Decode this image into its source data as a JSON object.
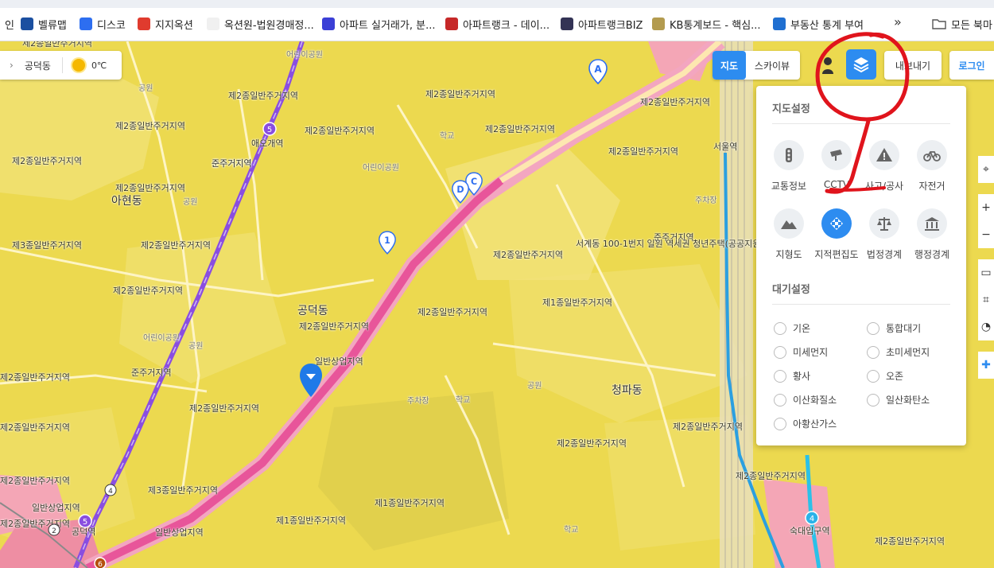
{
  "bookmarks": [
    {
      "label": "인",
      "icon": "blank-icon",
      "color": "#ffffff"
    },
    {
      "label": "벨류맵",
      "icon": "valuemap-icon",
      "color": "#1b4fa0"
    },
    {
      "label": "디스코",
      "icon": "disco-icon",
      "color": "#2d6ef0"
    },
    {
      "label": "지지옥션",
      "icon": "ggauction-icon",
      "color": "#e03b2e"
    },
    {
      "label": "옥션원-법원경매정...",
      "icon": "auction1-icon",
      "color": "#f0f0f0"
    },
    {
      "label": "아파트 실거래가, 분...",
      "icon": "hogangnono-icon",
      "color": "#3b3fd6"
    },
    {
      "label": "아파트랭크 - 데이...",
      "icon": "r-icon",
      "color": "#c62828"
    },
    {
      "label": "아파트랭크BIZ",
      "icon": "chart-icon",
      "color": "#333355"
    },
    {
      "label": "KB통계보드 - 핵심...",
      "icon": "kb-icon",
      "color": "#b39b4f"
    },
    {
      "label": "부동산 통계 부여",
      "icon": "reb-icon",
      "color": "#1f6fd1"
    }
  ],
  "bookmarks_more": "»",
  "bookmarks_folder": "모든 북마",
  "location": {
    "dong": "공덕동",
    "temperature": "0℃"
  },
  "map_controls": {
    "map": "지도",
    "skyview": "스카이뷰",
    "save": "내보내기",
    "login": "로그인"
  },
  "panel": {
    "map_settings_title": "지도설정",
    "map_options": [
      {
        "label": "교통정보",
        "icon": "traffic-light-icon",
        "active": false
      },
      {
        "label": "CCTV",
        "icon": "cctv-icon",
        "active": false
      },
      {
        "label": "사고/공사",
        "icon": "warning-icon",
        "active": false
      },
      {
        "label": "자전거",
        "icon": "bicycle-icon",
        "active": false
      },
      {
        "label": "지형도",
        "icon": "mountain-icon",
        "active": false
      },
      {
        "label": "지적편집도",
        "icon": "cadastral-icon",
        "active": true
      },
      {
        "label": "법정경계",
        "icon": "scale-icon",
        "active": false
      },
      {
        "label": "행정경계",
        "icon": "government-icon",
        "active": false
      }
    ],
    "air_settings_title": "대기설정",
    "air_options": [
      "기온",
      "통합대기",
      "미세먼지",
      "초미세먼지",
      "황사",
      "오존",
      "이산화질소",
      "일산화탄소",
      "아황산가스"
    ]
  },
  "map_labels": [
    {
      "text": "제2종일반주거지역",
      "cls": ""
    },
    {
      "text": "어린이공원",
      "cls": "small"
    },
    {
      "text": "제2종일반주거지역",
      "cls": ""
    },
    {
      "text": "제2종일반주거지역",
      "cls": ""
    },
    {
      "text": "제2종일반주거지역",
      "cls": ""
    },
    {
      "text": "제2종일반주거지역",
      "cls": ""
    },
    {
      "text": "제2종일반주거지역",
      "cls": ""
    },
    {
      "text": "제2종일반주거지역",
      "cls": ""
    },
    {
      "text": "제2종일반주거지역",
      "cls": ""
    },
    {
      "text": "제2종일반주거지역",
      "cls": ""
    },
    {
      "text": "제2종일반주거지역",
      "cls": ""
    },
    {
      "text": "준주거지역",
      "cls": ""
    },
    {
      "text": "아현동",
      "cls": "big"
    },
    {
      "text": "제3종일반주거지역",
      "cls": ""
    },
    {
      "text": "제2종일반주거지역",
      "cls": ""
    },
    {
      "text": "제2종일반주거지역",
      "cls": ""
    },
    {
      "text": "공덕동",
      "cls": "big"
    },
    {
      "text": "제2종일반주거지역",
      "cls": ""
    },
    {
      "text": "준주거지역",
      "cls": ""
    },
    {
      "text": "일반상업지역",
      "cls": ""
    },
    {
      "text": "제2종일반주거지역",
      "cls": ""
    },
    {
      "text": "제2종일반주거지역",
      "cls": ""
    },
    {
      "text": "제2종일반주거지역",
      "cls": ""
    },
    {
      "text": "제1종일반주거지역",
      "cls": ""
    },
    {
      "text": "청파동",
      "cls": "big"
    },
    {
      "text": "제3종일반주거지역",
      "cls": ""
    },
    {
      "text": "제1종일반주거지역",
      "cls": ""
    },
    {
      "text": "제1종일반주거지역",
      "cls": ""
    },
    {
      "text": "일반상업지역",
      "cls": ""
    },
    {
      "text": "일반상업지역",
      "cls": ""
    },
    {
      "text": "제2종일반주거지역",
      "cls": ""
    },
    {
      "text": "제2종일반주거지역",
      "cls": ""
    },
    {
      "text": "제2종일반주거지역",
      "cls": ""
    },
    {
      "text": "제2종일반주거지역",
      "cls": ""
    },
    {
      "text": "준주거지역",
      "cls": ""
    },
    {
      "text": "제2종일반주거지역",
      "cls": ""
    },
    {
      "text": "제2종일반주거지역",
      "cls": ""
    },
    {
      "text": "제2종일반주거지역",
      "cls": ""
    },
    {
      "text": "제2종일반주거지역",
      "cls": ""
    },
    {
      "text": "서계동 100-1번지 일원 역세권 청년주택(공공지원",
      "cls": ""
    },
    {
      "text": "준주거지역",
      "cls": ""
    },
    {
      "text": "애오개역",
      "cls": ""
    },
    {
      "text": "공덕역",
      "cls": ""
    },
    {
      "text": "서울역",
      "cls": ""
    },
    {
      "text": "숙대입구역",
      "cls": ""
    },
    {
      "text": "학교",
      "cls": "small"
    },
    {
      "text": "공원",
      "cls": "small"
    },
    {
      "text": "주차장",
      "cls": "small"
    },
    {
      "text": "학교",
      "cls": "small"
    },
    {
      "text": "공원",
      "cls": "small"
    },
    {
      "text": "어린이공원",
      "cls": "small"
    },
    {
      "text": "주차장",
      "cls": "small"
    },
    {
      "text": "학교",
      "cls": "small"
    },
    {
      "text": "공원",
      "cls": "small"
    },
    {
      "text": "어린이공원",
      "cls": "small"
    },
    {
      "text": "공원",
      "cls": "small"
    }
  ],
  "map_markers": [
    "A",
    "C",
    "D",
    "1"
  ],
  "metro_badges": [
    "5",
    "5",
    "6",
    "2",
    "4",
    "4"
  ]
}
